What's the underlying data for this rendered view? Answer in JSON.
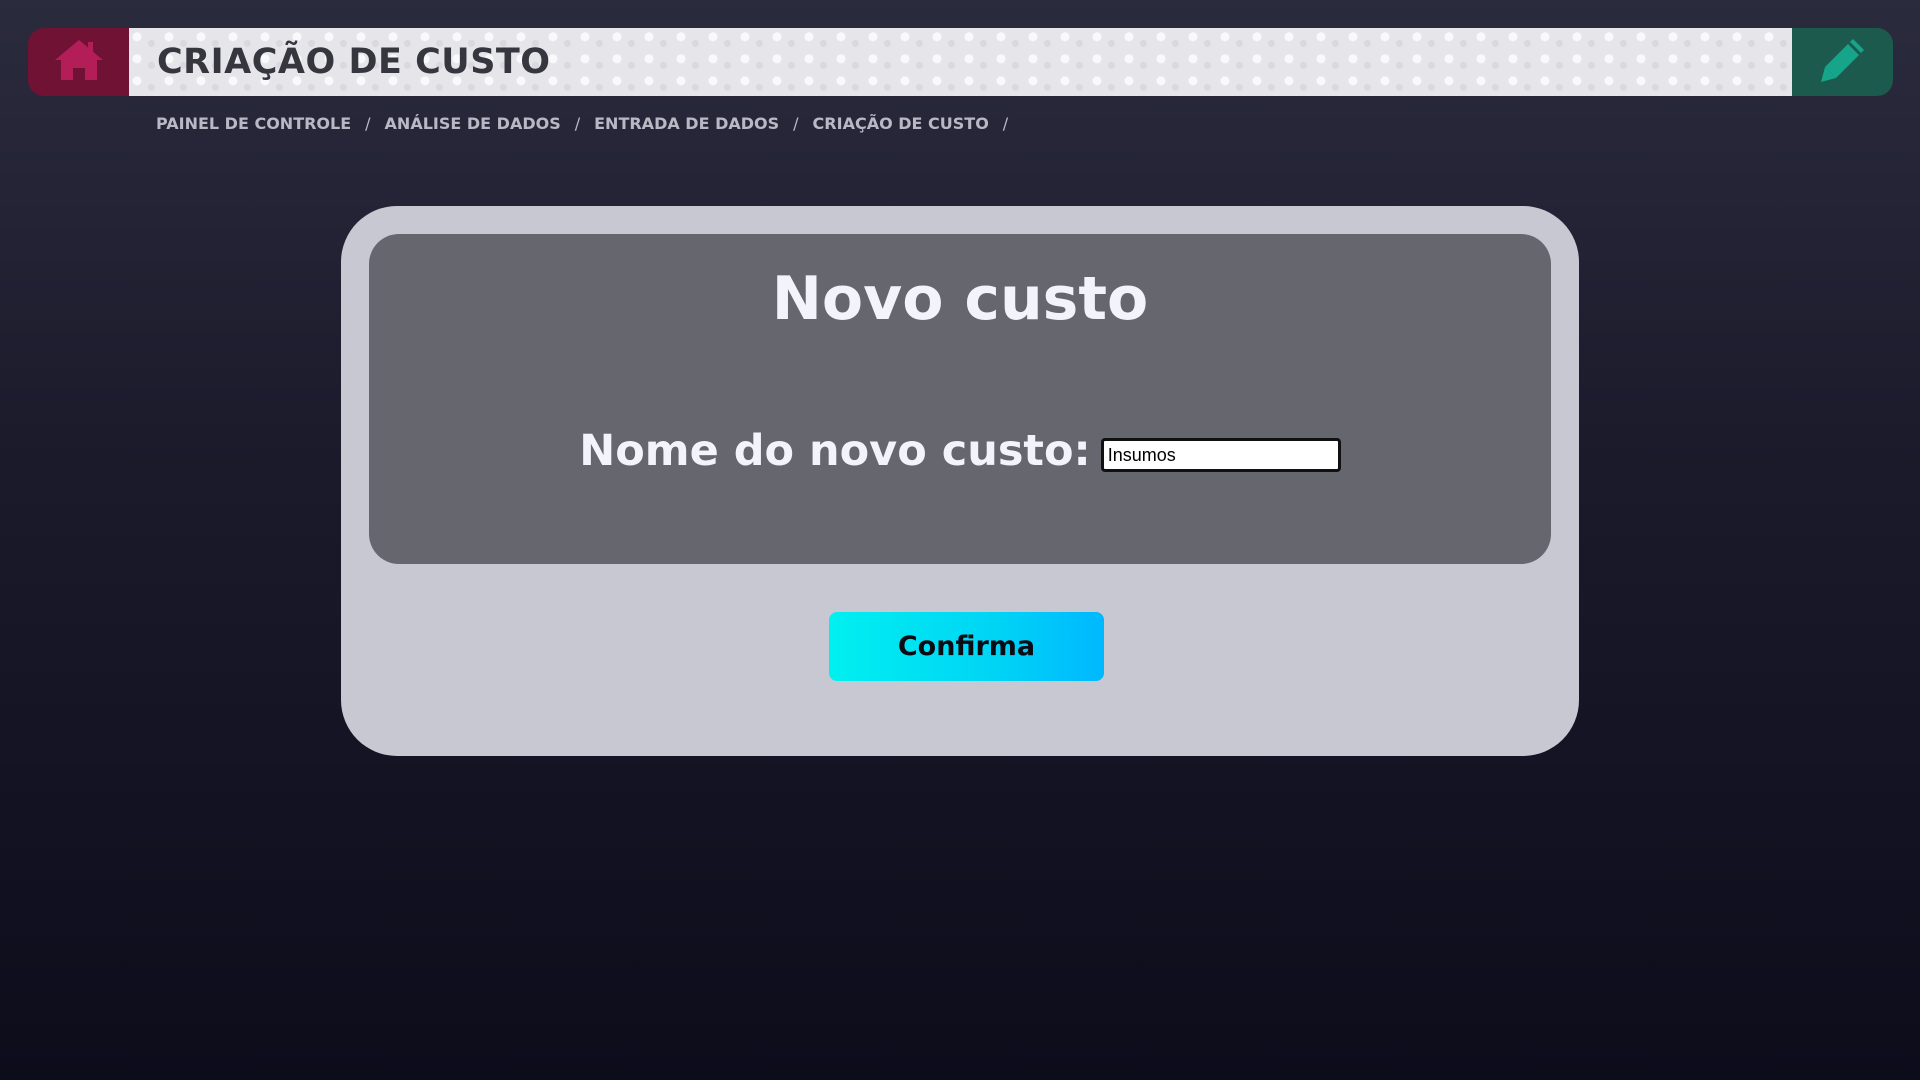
{
  "header": {
    "title": "CRIAÇÃO DE CUSTO",
    "home_icon": "home-icon",
    "edit_icon": "pencil-icon",
    "colors": {
      "home_bg": "#6f1233",
      "home_icon": "#b41e58",
      "edit_bg": "#1b5a4c",
      "edit_icon": "#16a58a"
    }
  },
  "breadcrumb": {
    "items": [
      "PAINEL DE CONTROLE",
      "ANÁLISE DE DADOS",
      "ENTRADA DE DADOS",
      "CRIAÇÃO DE CUSTO"
    ],
    "separator": "/"
  },
  "card": {
    "title": "Novo custo",
    "field_label": "Nome do novo custo:",
    "input_value": "Insumos",
    "confirm_label": "Confirma"
  }
}
